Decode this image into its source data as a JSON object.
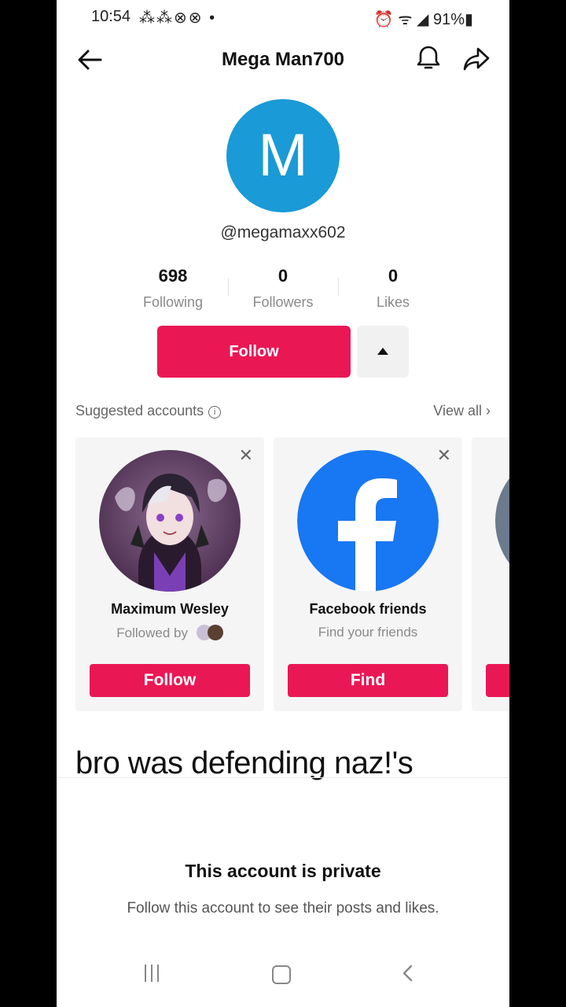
{
  "status_bar": {
    "time": "10:54",
    "left_icons": "⁂⁂⊗⊗ •",
    "right_icons": "⏰ ᯤ ◢ 91%▮"
  },
  "header": {
    "title": "Mega Man700"
  },
  "profile": {
    "avatar_letter": "M",
    "handle": "@megamaxx602",
    "stats": [
      {
        "value": "698",
        "label": "Following"
      },
      {
        "value": "0",
        "label": "Followers"
      },
      {
        "value": "0",
        "label": "Likes"
      }
    ],
    "follow_label": "Follow"
  },
  "suggested": {
    "heading": "Suggested accounts",
    "view_all": "View all",
    "cards": [
      {
        "name": "Maximum Wesley",
        "sub": "Followed by",
        "button": "Follow"
      },
      {
        "name": "Facebook friends",
        "sub": "Find your friends",
        "button": "Find"
      }
    ]
  },
  "caption": "bro was defending naz!'s",
  "private": {
    "title": "This account is private",
    "subtitle": "Follow this account to see their posts and likes."
  },
  "colors": {
    "accent": "#ea1755",
    "avatar_bg": "#1a9ad6",
    "facebook": "#1877f2"
  }
}
